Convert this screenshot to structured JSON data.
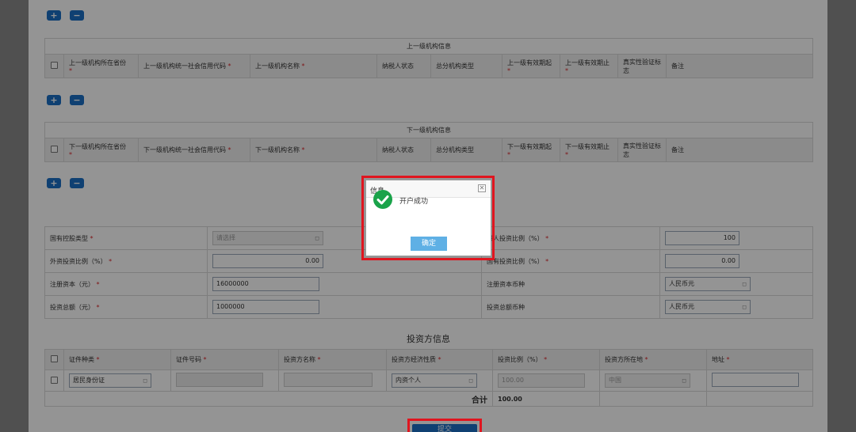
{
  "add_label": "+",
  "remove_label": "−",
  "upper_level": {
    "title": "上一级机构信息",
    "headers": [
      "上一级机构所在省份",
      "上一级机构统一社会信用代码",
      "上一级机构名称",
      "纳税人状态",
      "总分机构类型",
      "上一级有效期起",
      "上一级有效期止",
      "真实性验证标志",
      "备注"
    ]
  },
  "lower_level": {
    "title": "下一级机构信息",
    "headers": [
      "下一级机构所在省份",
      "下一级机构统一社会信用代码",
      "下一级机构名称",
      "纳税人状态",
      "总分机构类型",
      "下一级有效期起",
      "下一级有效期止",
      "真实性验证标志",
      "备注"
    ]
  },
  "required_mark": "*",
  "capital": {
    "state_type_label": "国有控股类型",
    "state_type_placeholder": "请选择",
    "natural_ratio_label": "然人投资比例（%）",
    "natural_ratio_value": "100",
    "foreign_ratio_label": "外资投资比例（%）",
    "foreign_ratio_value": "0.00",
    "state_ratio_label": "国有投资比例（%）",
    "state_ratio_value": "0.00",
    "reg_capital_label": "注册资本（元）",
    "reg_capital_value": "16000000",
    "reg_currency_label": "注册资本币种",
    "reg_currency_value": "人民币元",
    "total_invest_label": "投资总额（元）",
    "total_invest_value": "1000000",
    "invest_currency_label": "投资总额币种",
    "invest_currency_value": "人民币元"
  },
  "investor": {
    "title": "投资方信息",
    "headers": [
      "证件种类",
      "证件号码",
      "投资方名称",
      "投资方经济性质",
      "投资比例（%）",
      "投资方所在地",
      "地址"
    ],
    "row": {
      "id_type": "居民身份证",
      "nature": "内资个人",
      "ratio": "100.00",
      "location": "中国"
    },
    "sum_label": "合计",
    "sum_value": "100.00"
  },
  "submit_label": "提交",
  "dialog": {
    "title": "信息",
    "close": "✕",
    "message": "开户成功",
    "confirm": "确定"
  }
}
